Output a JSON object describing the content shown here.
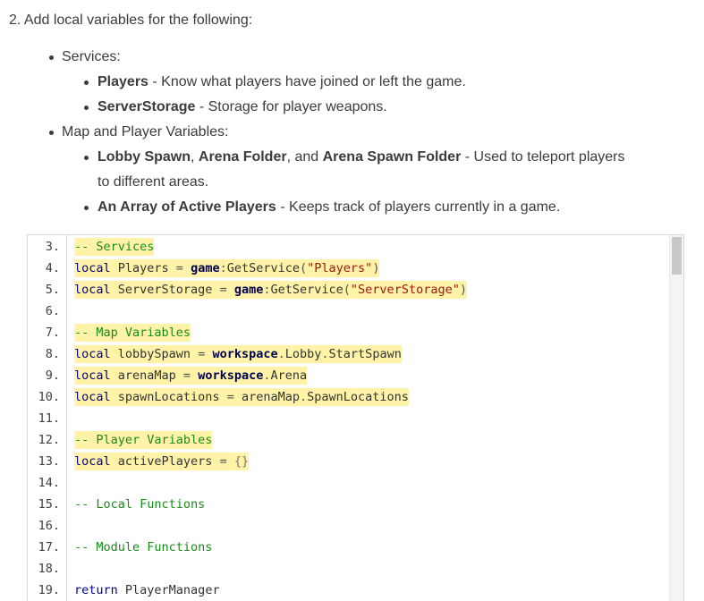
{
  "instructions": {
    "step_title": "2. Add local variables for the following:",
    "bullets": [
      {
        "label": "Services:",
        "subitems": [
          {
            "bold": "Players",
            "rest": " - Know what players have joined or left the game."
          },
          {
            "bold": "ServerStorage",
            "rest": " - Storage for player weapons."
          }
        ]
      },
      {
        "label": "Map and Player Variables:",
        "subitems": [
          {
            "parts": [
              {
                "bold": "Lobby Spawn"
              },
              {
                "text": ", "
              },
              {
                "bold": "Arena Folder"
              },
              {
                "text": ", and "
              },
              {
                "bold": "Arena Spawn Folder"
              },
              {
                "text": " - Used to teleport players"
              }
            ],
            "continuation": "to different areas."
          },
          {
            "bold": "An Array of Active Players",
            "rest": " - Keeps track of players currently in a game."
          }
        ]
      }
    ]
  },
  "code": {
    "lines": [
      {
        "num": "3.",
        "hl": true,
        "tokens": [
          [
            "cm",
            "-- Services"
          ]
        ]
      },
      {
        "num": "4.",
        "hl": true,
        "tokens": [
          [
            "kw",
            "local"
          ],
          [
            "id",
            " Players "
          ],
          [
            "op",
            "="
          ],
          [
            "id",
            " "
          ],
          [
            "glob",
            "game"
          ],
          [
            "op",
            ":"
          ],
          [
            "id",
            "GetService"
          ],
          [
            "op",
            "("
          ],
          [
            "str",
            "\"Players\""
          ],
          [
            "op",
            ")"
          ]
        ]
      },
      {
        "num": "5.",
        "hl": true,
        "tokens": [
          [
            "kw",
            "local"
          ],
          [
            "id",
            " ServerStorage "
          ],
          [
            "op",
            "="
          ],
          [
            "id",
            " "
          ],
          [
            "glob",
            "game"
          ],
          [
            "op",
            ":"
          ],
          [
            "id",
            "GetService"
          ],
          [
            "op",
            "("
          ],
          [
            "str",
            "\"ServerStorage\""
          ],
          [
            "op",
            ")"
          ]
        ]
      },
      {
        "num": "6.",
        "hl": false,
        "tokens": []
      },
      {
        "num": "7.",
        "hl": true,
        "tokens": [
          [
            "cm",
            "-- Map Variables"
          ]
        ]
      },
      {
        "num": "8.",
        "hl": true,
        "tokens": [
          [
            "kw",
            "local"
          ],
          [
            "id",
            " lobbySpawn "
          ],
          [
            "op",
            "="
          ],
          [
            "id",
            " "
          ],
          [
            "glob",
            "workspace"
          ],
          [
            "op",
            "."
          ],
          [
            "id",
            "Lobby"
          ],
          [
            "op",
            "."
          ],
          [
            "id",
            "StartSpawn"
          ]
        ]
      },
      {
        "num": "9.",
        "hl": true,
        "tokens": [
          [
            "kw",
            "local"
          ],
          [
            "id",
            " arenaMap "
          ],
          [
            "op",
            "="
          ],
          [
            "id",
            " "
          ],
          [
            "glob",
            "workspace"
          ],
          [
            "op",
            "."
          ],
          [
            "id",
            "Arena"
          ]
        ]
      },
      {
        "num": "10.",
        "hl": true,
        "tokens": [
          [
            "kw",
            "local"
          ],
          [
            "id",
            " spawnLocations "
          ],
          [
            "op",
            "="
          ],
          [
            "id",
            " arenaMap"
          ],
          [
            "op",
            "."
          ],
          [
            "id",
            "SpawnLocations"
          ]
        ]
      },
      {
        "num": "11.",
        "hl": false,
        "tokens": []
      },
      {
        "num": "12.",
        "hl": true,
        "tokens": [
          [
            "cm",
            "-- Player Variables"
          ]
        ]
      },
      {
        "num": "13.",
        "hl": true,
        "tokens": [
          [
            "kw",
            "local"
          ],
          [
            "id",
            " activePlayers "
          ],
          [
            "op",
            "="
          ],
          [
            "id",
            " "
          ],
          [
            "dim",
            "{}"
          ]
        ]
      },
      {
        "num": "14.",
        "hl": false,
        "tokens": []
      },
      {
        "num": "15.",
        "hl": false,
        "tokens": [
          [
            "cm",
            "-- Local Functions"
          ]
        ]
      },
      {
        "num": "16.",
        "hl": false,
        "tokens": []
      },
      {
        "num": "17.",
        "hl": false,
        "tokens": [
          [
            "cm",
            "-- Module Functions"
          ]
        ]
      },
      {
        "num": "18.",
        "hl": false,
        "tokens": []
      },
      {
        "num": "19.",
        "hl": false,
        "tokens": [
          [
            "kw",
            "return"
          ],
          [
            "id",
            " PlayerManager"
          ]
        ]
      }
    ]
  }
}
